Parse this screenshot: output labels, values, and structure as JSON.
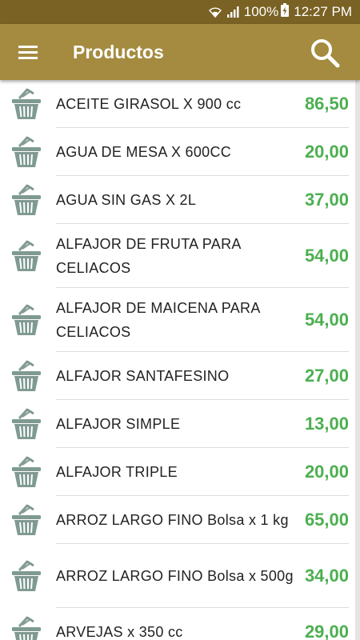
{
  "status_bar": {
    "battery": "100%",
    "time": "12:27 PM",
    "icons": [
      "wifi-icon",
      "signal-icon",
      "battery-charging-icon"
    ]
  },
  "app_bar": {
    "title": "Productos",
    "icons": [
      "menu-icon",
      "search-icon"
    ]
  },
  "colors": {
    "status_bar": "#7a6224",
    "app_bar": "#a48b40",
    "price": "#4caf50",
    "basket_icon": "#7f9a92"
  },
  "products": [
    {
      "name": "ACEITE GIRASOL X 900 cc",
      "price": "86,50"
    },
    {
      "name": "AGUA DE MESA X 600CC",
      "price": "20,00"
    },
    {
      "name": "AGUA SIN GAS X 2L",
      "price": "37,00"
    },
    {
      "name": "ALFAJOR DE FRUTA PARA CELIACOS",
      "price": "54,00"
    },
    {
      "name": "ALFAJOR DE MAICENA PARA CELIACOS",
      "price": "54,00"
    },
    {
      "name": "ALFAJOR SANTAFESINO",
      "price": "27,00"
    },
    {
      "name": "ALFAJOR SIMPLE",
      "price": "13,00"
    },
    {
      "name": "ALFAJOR TRIPLE",
      "price": "20,00"
    },
    {
      "name": "ARROZ LARGO FINO Bolsa x 1 kg",
      "price": "65,00"
    },
    {
      "name": "ARROZ LARGO FINO Bolsa x 500g",
      "price": "34,00"
    },
    {
      "name": "ARVEJAS x 350 cc",
      "price": "29,00"
    }
  ]
}
